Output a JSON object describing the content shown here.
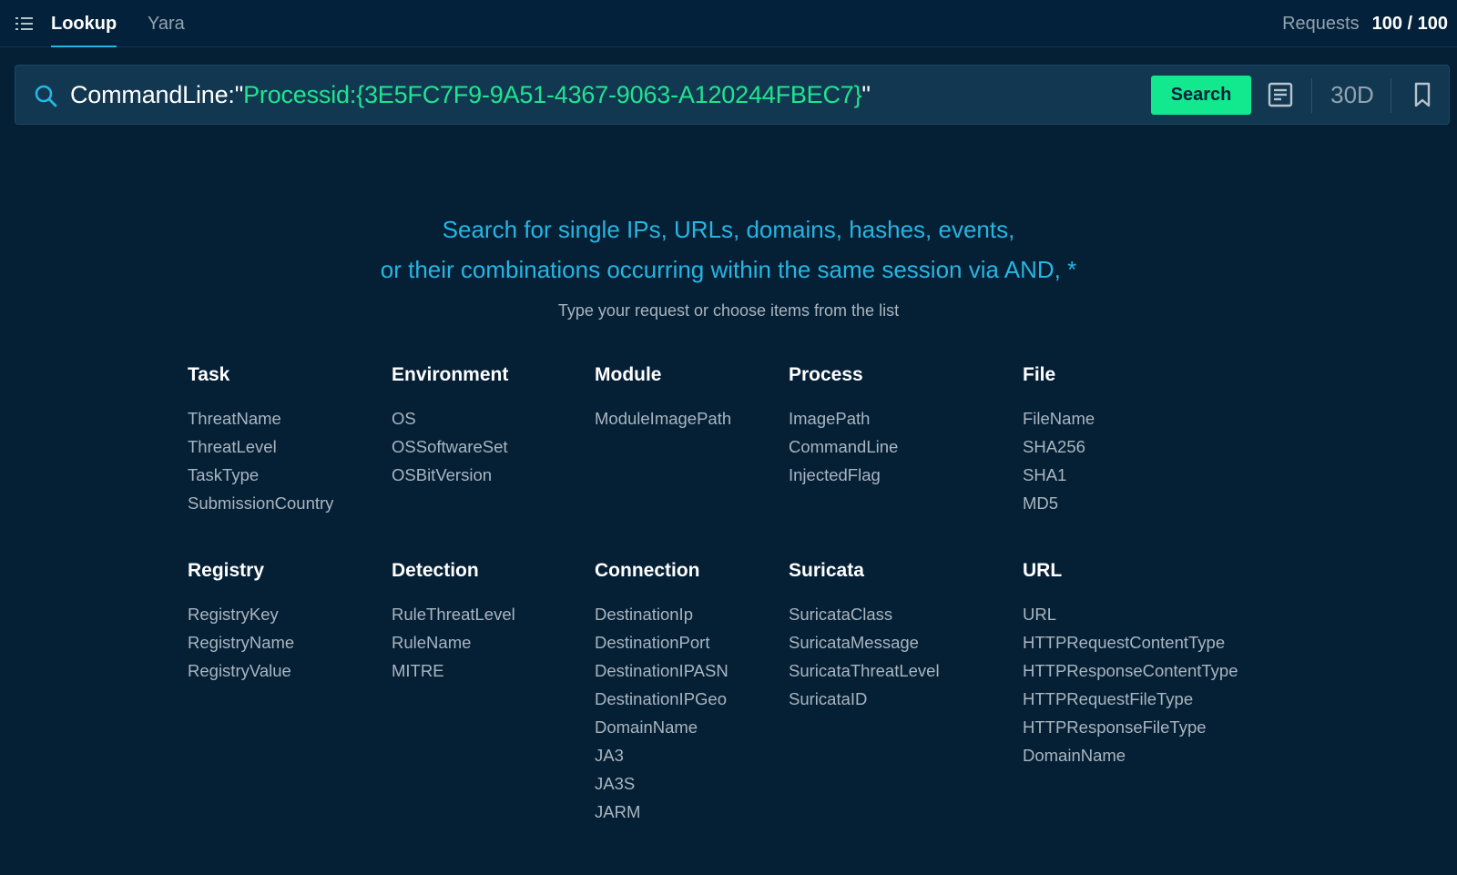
{
  "nav": {
    "tabs": [
      {
        "label": "Lookup",
        "active": true
      },
      {
        "label": "Yara",
        "active": false
      }
    ],
    "requests_label": "Requests",
    "requests_value": "100 / 100"
  },
  "search": {
    "query_key": "CommandLine:",
    "query_open_quote": "\"",
    "query_value": "Processid:{3E5FC7F9-9A51-4367-9063-A120244FBEC7}",
    "query_close_quote": "\"",
    "button_label": "Search",
    "period": "30D"
  },
  "hero": {
    "line1": "Search for single IPs, URLs, domains, hashes, events,",
    "line2": "or their combinations occurring within the same session via AND, *",
    "hint": "Type your request or choose items from the list"
  },
  "categories": [
    {
      "title": "Task",
      "items": [
        "ThreatName",
        "ThreatLevel",
        "TaskType",
        "SubmissionCountry"
      ]
    },
    {
      "title": "Environment",
      "items": [
        "OS",
        "OSSoftwareSet",
        "OSBitVersion"
      ]
    },
    {
      "title": "Module",
      "items": [
        "ModuleImagePath"
      ]
    },
    {
      "title": "Process",
      "items": [
        "ImagePath",
        "CommandLine",
        "InjectedFlag"
      ]
    },
    {
      "title": "File",
      "items": [
        "FileName",
        "SHA256",
        "SHA1",
        "MD5"
      ]
    },
    {
      "title": "Registry",
      "items": [
        "RegistryKey",
        "RegistryName",
        "RegistryValue"
      ]
    },
    {
      "title": "Detection",
      "items": [
        "RuleThreatLevel",
        "RuleName",
        "MITRE"
      ]
    },
    {
      "title": "Connection",
      "items": [
        "DestinationIp",
        "DestinationPort",
        "DestinationIPASN",
        "DestinationIPGeo",
        "DomainName",
        "JA3",
        "JA3S",
        "JARM"
      ]
    },
    {
      "title": "Suricata",
      "items": [
        "SuricataClass",
        "SuricataMessage",
        "SuricataThreatLevel",
        "SuricataID"
      ]
    },
    {
      "title": "URL",
      "items": [
        "URL",
        "HTTPRequestContentType",
        "HTTPResponseContentType",
        "HTTPRequestFileType",
        "HTTPResponseFileType",
        "DomainName"
      ]
    }
  ],
  "colors": {
    "background": "#051f35",
    "accent": "#25b6e3",
    "search_button": "#12e88d",
    "query_value": "#1ee58f"
  },
  "icons": [
    "menu-icon",
    "search-icon",
    "list-icon",
    "bookmark-icon"
  ]
}
